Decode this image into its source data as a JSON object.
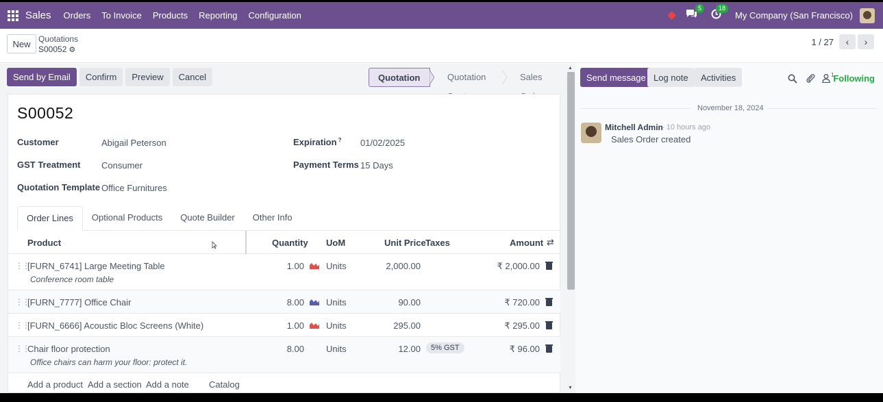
{
  "nav": {
    "brand": "Sales",
    "menu": [
      "Orders",
      "To Invoice",
      "Products",
      "Reporting",
      "Configuration"
    ],
    "messages_count": "5",
    "activities_count": "18",
    "company": "My Company (San Francisco)"
  },
  "control": {
    "new_label": "New",
    "breadcrumb_parent": "Quotations",
    "breadcrumb_current": "S00052",
    "pager": "1 / 27"
  },
  "actions": {
    "send_email": "Send by Email",
    "confirm": "Confirm",
    "preview": "Preview",
    "cancel": "Cancel"
  },
  "status": {
    "stages": [
      "Quotation",
      "Quotation Sent",
      "Sales Order"
    ],
    "active": "Quotation"
  },
  "record": {
    "name": "S00052",
    "fields": {
      "customer_label": "Customer",
      "customer": "Abigail Peterson",
      "gst_label": "GST Treatment",
      "gst": "Consumer",
      "template_label": "Quotation Template",
      "template": "Office Furnitures",
      "expiration_label": "Expiration",
      "expiration_tip": "?",
      "expiration": "01/02/2025",
      "terms_label": "Payment Terms",
      "terms": "15 Days"
    }
  },
  "tabs": [
    "Order Lines",
    "Optional Products",
    "Quote Builder",
    "Other Info"
  ],
  "lines": {
    "headers": {
      "product": "Product",
      "quantity": "Quantity",
      "uom": "UoM",
      "unit_price": "Unit Price",
      "taxes": "Taxes",
      "amount": "Amount"
    },
    "rows": [
      {
        "product": "[FURN_6741] Large Meeting Table",
        "description": "Conference room table",
        "quantity": "1.00",
        "forecast_color": "#d9534f",
        "uom": "Units",
        "unit_price": "2,000.00",
        "taxes": "",
        "amount": "₹ 2,000.00"
      },
      {
        "product": "[FURN_7777] Office Chair",
        "description": "",
        "quantity": "8.00",
        "forecast_color": "#5b5fa8",
        "uom": "Units",
        "unit_price": "90.00",
        "taxes": "",
        "amount": "₹ 720.00"
      },
      {
        "product": "[FURN_6666] Acoustic Bloc Screens (White)",
        "description": "",
        "quantity": "1.00",
        "forecast_color": "#d9534f",
        "uom": "Units",
        "unit_price": "295.00",
        "taxes": "",
        "amount": "₹ 295.00"
      },
      {
        "product": "Chair floor protection",
        "description": "Office chairs can harm your floor: protect it.",
        "quantity": "8.00",
        "forecast_color": "",
        "uom": "Units",
        "unit_price": "12.00",
        "taxes": "5% GST",
        "amount": "₹ 96.00"
      }
    ],
    "add_product": "Add a product",
    "add_section": "Add a section",
    "add_note": "Add a note",
    "catalog": "Catalog"
  },
  "chatter": {
    "send_message": "Send message",
    "log_note": "Log note",
    "activities": "Activities",
    "followers_count": "1",
    "following": "Following",
    "date": "November 18, 2024",
    "author": "Mitchell Admin",
    "ago": "- 10 hours ago",
    "message": "Sales Order created"
  }
}
